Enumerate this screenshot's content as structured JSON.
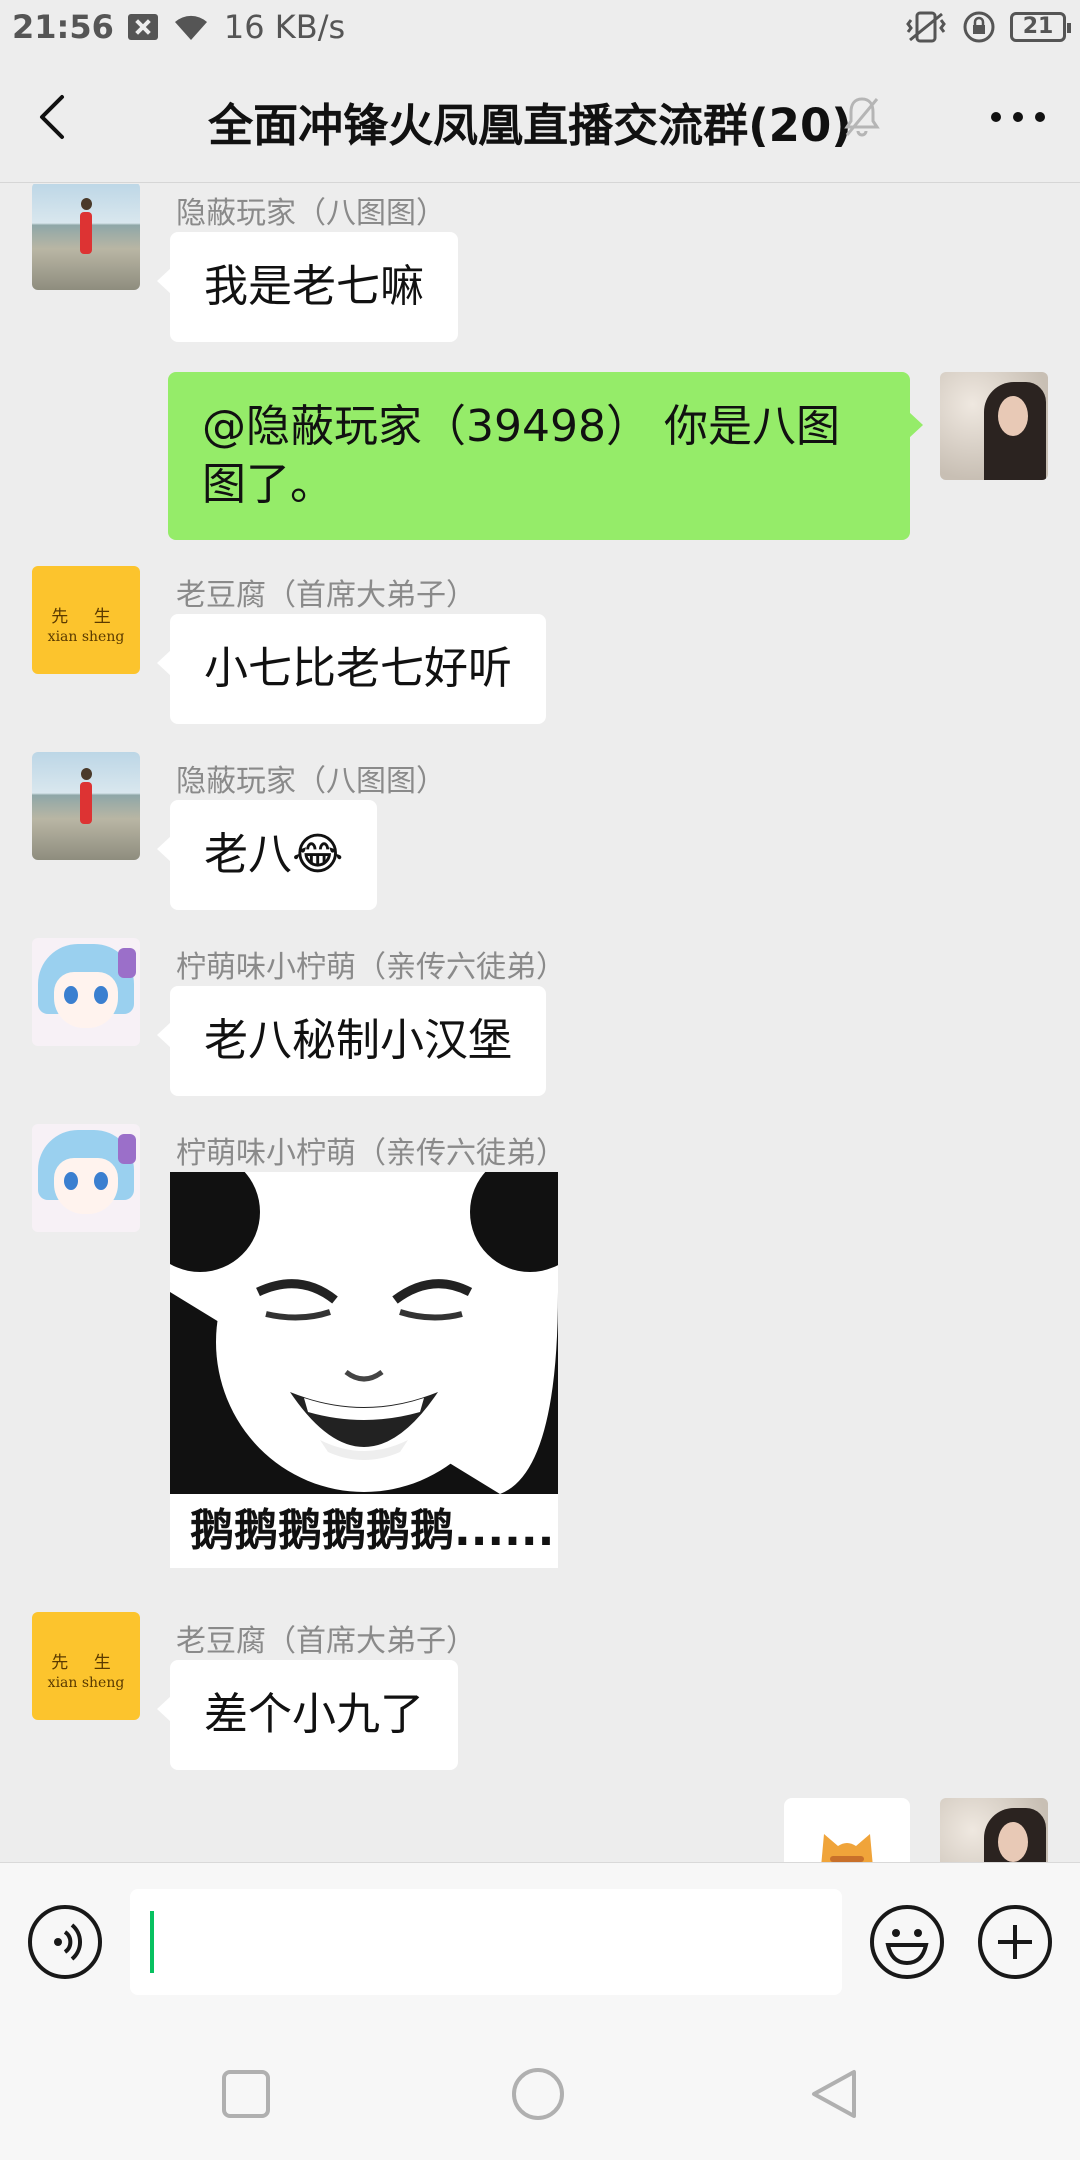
{
  "status_bar": {
    "time": "21:56",
    "speed": "16 KB/s",
    "battery": "21",
    "icons": [
      "notification-box-icon",
      "wifi-icon",
      "vibrate-icon",
      "rotation-lock-icon",
      "battery-icon"
    ]
  },
  "header": {
    "title": "全面冲锋火凤凰直播交流群(20)",
    "icons": [
      "back-arrow-icon",
      "muted-bell-icon",
      "more-dots-icon"
    ]
  },
  "messages": [
    {
      "side": "left",
      "sender": "隐蔽玩家（八图图）",
      "avatar": "beach-photo",
      "text": "我是老七嘛"
    },
    {
      "side": "right",
      "avatar": "girl-photo",
      "text": "@隐蔽玩家（39498） 你是八图图了。"
    },
    {
      "side": "left",
      "sender": "老豆腐（首席大弟子）",
      "avatar": "xian-sheng",
      "text": "小七比老七好听"
    },
    {
      "side": "left",
      "sender": "隐蔽玩家（八图图）",
      "avatar": "beach-photo",
      "text": "老八😂"
    },
    {
      "side": "left",
      "sender": "柠萌味小柠萌（亲传六徒弟）",
      "avatar": "anime-girl",
      "text": "老八秘制小汉堡"
    },
    {
      "side": "left",
      "sender": "柠萌味小柠萌（亲传六徒弟）",
      "avatar": "anime-girl",
      "sticker_caption": "鹅鹅鹅鹅鹅鹅......",
      "sticker": "panda-face-meme"
    },
    {
      "side": "left",
      "sender": "老豆腐（首席大弟子）",
      "avatar": "xian-sheng",
      "text": "差个小九了"
    },
    {
      "side": "right",
      "avatar": "girl-photo",
      "sticker": "cat-sticker-partial"
    }
  ],
  "avatar_text": {
    "xs_line1": "先 生",
    "xs_line2": "xian sheng"
  },
  "input_bar": {
    "value": "",
    "icons": [
      "voice-icon",
      "emoji-icon",
      "plus-icon"
    ],
    "caret_color": "#07c160"
  },
  "nav_bar": {
    "icons": [
      "recents-square-icon",
      "home-circle-icon",
      "back-triangle-icon"
    ]
  },
  "colors": {
    "background": "#ededed",
    "my_bubble": "#95ec69",
    "their_bubble": "#ffffff"
  }
}
